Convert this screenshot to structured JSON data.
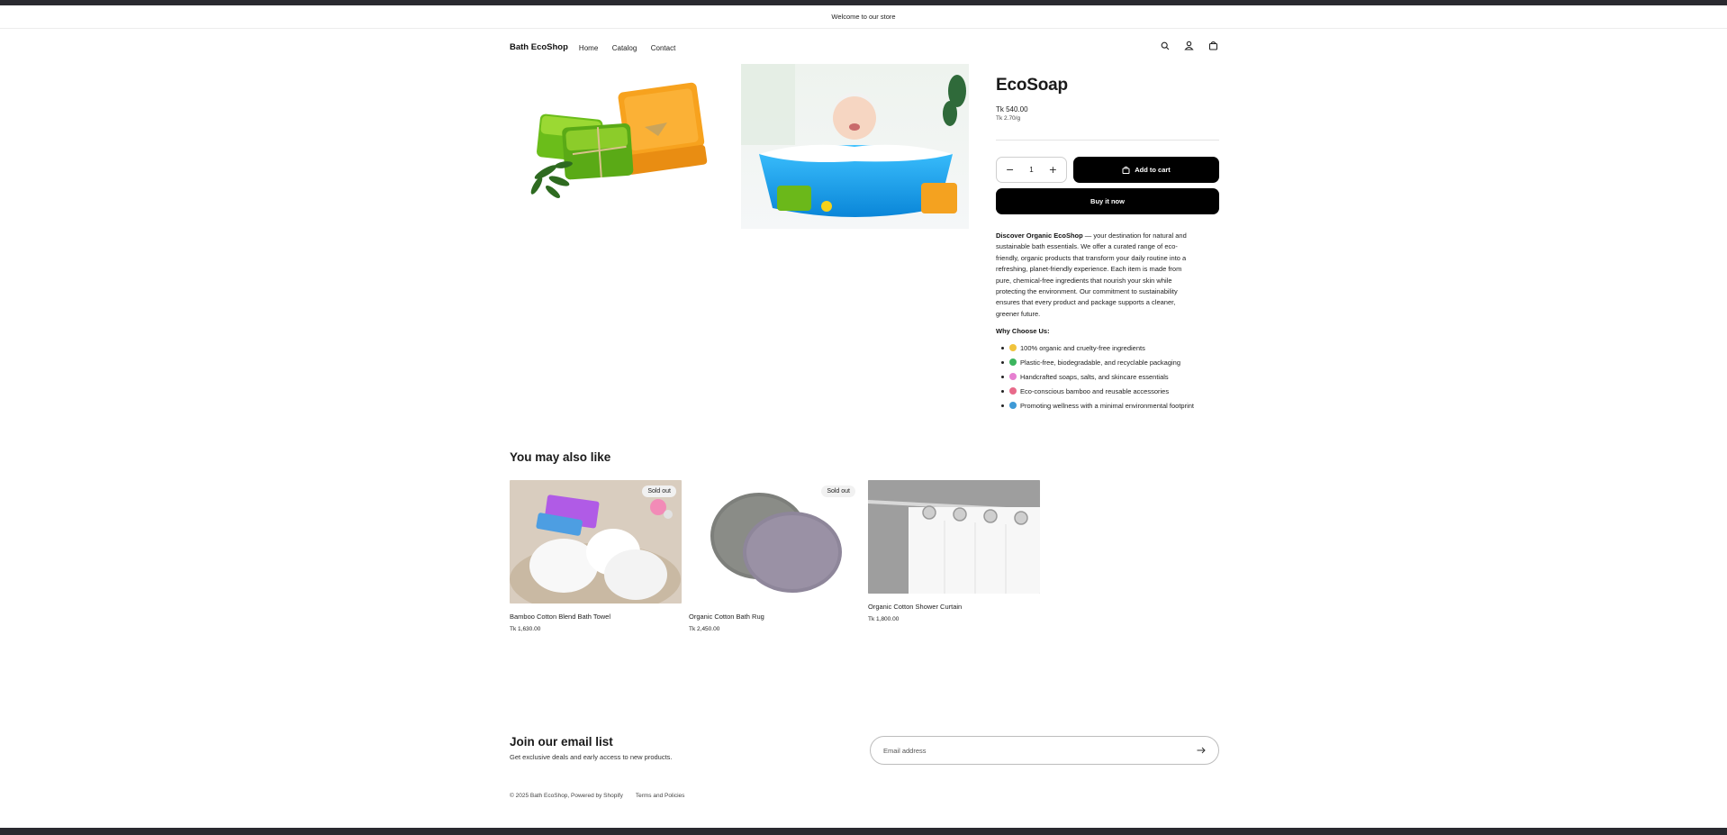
{
  "announcement": {
    "text": "Welcome to our store"
  },
  "header": {
    "logo": "Bath EcoShop",
    "nav": [
      "Home",
      "Catalog",
      "Contact"
    ],
    "icons": [
      "search-icon",
      "account-icon",
      "cart-icon"
    ]
  },
  "product": {
    "title": "EcoSoap",
    "price": "Tk 540.00",
    "unit_price": "Tk 2.70/g",
    "quantity": "1",
    "add_to_cart": "Add to cart",
    "buy_now": "Buy it now",
    "description_bold": "Discover Organic EcoShop",
    "description_rest": " — your destination for natural and sustainable bath essentials. We offer a curated range of eco-friendly, organic products that transform your daily routine into a refreshing, planet-friendly experience. Each item is made from pure, chemical-free ingredients that nourish your skin while protecting the environment. Our commitment to sustainability ensures that every product and package supports a cleaner, greener future.",
    "why_title": "Why Choose Us:",
    "why_items": [
      "100% organic and cruelty-free ingredients",
      "Plastic-free, biodegradable, and recyclable packaging",
      "Handcrafted soaps, salts, and skincare essentials",
      "Eco-conscious bamboo and reusable accessories",
      "Promoting wellness with a minimal environmental footprint"
    ],
    "why_icons": [
      "leaf-icon",
      "recycle-icon",
      "soap-icon",
      "bamboo-icon",
      "globe-icon"
    ]
  },
  "recommendations": {
    "title": "You may also like",
    "items": [
      {
        "name": "Bamboo Cotton Blend Bath Towel",
        "price": "Tk 1,630.00",
        "badge": "Sold out"
      },
      {
        "name": "Organic Cotton Bath Rug",
        "price": "Tk 2,450.00",
        "badge": "Sold out"
      },
      {
        "name": "Organic Cotton Shower Curtain",
        "price": "Tk 1,800.00",
        "badge": ""
      }
    ]
  },
  "newsletter": {
    "title": "Join our email list",
    "subtitle": "Get exclusive deals and early access to new products.",
    "placeholder": "Email address"
  },
  "footer": {
    "copyright": "© 2025 Bath EcoShop, Powered by Shopify",
    "policies": "Terms and Policies"
  }
}
